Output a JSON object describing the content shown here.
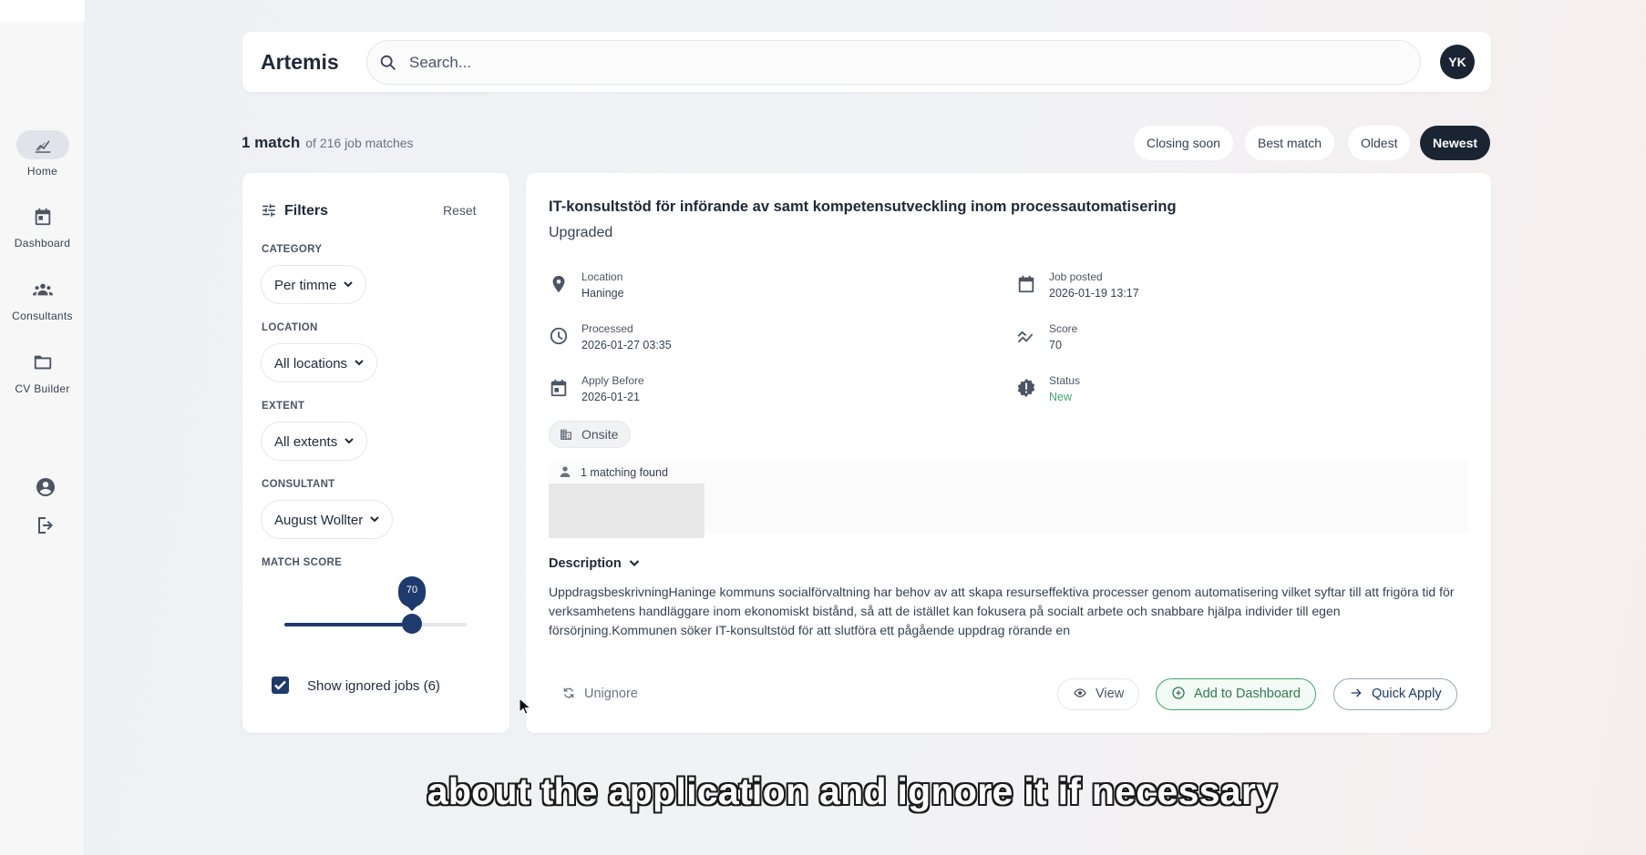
{
  "app": {
    "title": "Artemis",
    "avatar_initials": "YK"
  },
  "search": {
    "placeholder": "Search...",
    "value": ""
  },
  "sidebar": {
    "items": [
      {
        "label": "Home",
        "icon": "chart-icon",
        "active": true
      },
      {
        "label": "Dashboard",
        "icon": "calendar-icon",
        "active": false
      },
      {
        "label": "Consultants",
        "icon": "group-icon",
        "active": false
      },
      {
        "label": "CV Builder",
        "icon": "folder-icon",
        "active": false
      }
    ],
    "bottom_icons": [
      "account-icon",
      "logout-icon"
    ]
  },
  "results": {
    "count": "1 match",
    "total": "of 216 job matches"
  },
  "sort": {
    "options": [
      "Closing soon",
      "Best match",
      "Oldest",
      "Newest"
    ],
    "selected": "Newest"
  },
  "filters": {
    "title": "Filters",
    "reset": "Reset",
    "category": {
      "label": "CATEGORY",
      "value": "Per timme"
    },
    "location": {
      "label": "LOCATION",
      "value": "All locations"
    },
    "extent": {
      "label": "EXTENT",
      "value": "All extents"
    },
    "consultant": {
      "label": "CONSULTANT",
      "value": "August Wollter"
    },
    "match_score": {
      "label": "MATCH SCORE",
      "value": "70",
      "fraction": 0.7
    },
    "show_ignored": {
      "label": "Show ignored jobs (6)",
      "checked": true
    }
  },
  "job": {
    "title": "IT-konsultstöd för införande av samt kompetensutveckling inom processautomatisering",
    "subtitle": "Upgraded",
    "location": {
      "label": "Location",
      "value": "Haninge"
    },
    "job_posted": {
      "label": "Job posted",
      "value": "2026-01-19 13:17"
    },
    "processed": {
      "label": "Processed",
      "value": "2026-01-27 03:35"
    },
    "score": {
      "label": "Score",
      "value": "70"
    },
    "apply_before": {
      "label": "Apply Before",
      "value": "2026-01-21"
    },
    "status": {
      "label": "Status",
      "value": "New",
      "color": "#3fa56d"
    },
    "work_mode": "Onsite",
    "matching": "1 matching found",
    "description_label": "Description",
    "description": "UppdragsbeskrivningHaninge kommuns socialförvaltning har behov av att skapa resurseffektiva processer genom automatisering vilket syftar till att frigöra tid för verksamhetens handläggare inom ekonomiskt bistånd, så att de istället kan fokusera på socialt arbete och snabbare hjälpa individer till egen försörjning.Kommunen söker IT-konsultstöd för att slutföra ett pågående uppdrag rörande en",
    "actions": {
      "unignore": "Unignore",
      "view": "View",
      "add_dashboard": "Add to Dashboard",
      "quick_apply": "Quick Apply"
    }
  },
  "caption": "about the application and ignore it if necessary",
  "colors": {
    "accent": "#1e3a6e",
    "dark": "#1b2433",
    "success": "#3fa56d"
  }
}
